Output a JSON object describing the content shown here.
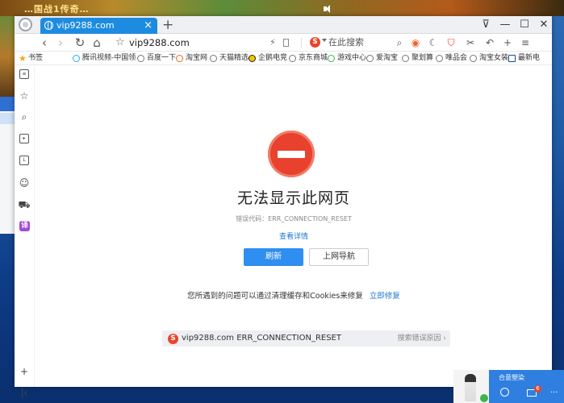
{
  "background": {
    "game_banner_text": "…国战1传奇…"
  },
  "tab": {
    "title": "vip9288.com"
  },
  "toolbar": {
    "url": "vip9288.com",
    "search_placeholder": "在此搜索"
  },
  "bookmarks": [
    {
      "label": "书签",
      "icon": "star-icon"
    },
    {
      "label": "腾讯视频-中国领",
      "icon": "video-icon"
    },
    {
      "label": "百度一下",
      "icon": "globe-icon"
    },
    {
      "label": "淘宝网",
      "icon": "taobao-icon"
    },
    {
      "label": "天猫精选",
      "icon": "globe-icon"
    },
    {
      "label": "企鹅电竞",
      "icon": "penguin-icon"
    },
    {
      "label": "京东商城",
      "icon": "globe-icon"
    },
    {
      "label": "游戏中心",
      "icon": "game-icon"
    },
    {
      "label": "爱淘宝",
      "icon": "globe-icon"
    },
    {
      "label": "聚划算",
      "icon": "globe-icon"
    },
    {
      "label": "唯品会",
      "icon": "globe-icon"
    },
    {
      "label": "淘宝女装",
      "icon": "globe-icon"
    },
    {
      "label": "最新电",
      "icon": "page-icon"
    }
  ],
  "error_page": {
    "title": "无法显示此网页",
    "error_code": "错误代码：ERR_CONNECTION_RESET",
    "detail_link": "查看详情",
    "refresh_button": "刷新",
    "nav_button": "上网导航",
    "hint_text": "您所遇到的问题可以通过清理缓存和Cookies来修复",
    "fix_link": "立即修复",
    "bar_text": "vip9288.com ERR_CONNECTION_RESET",
    "bar_right": "搜索错误原因 ›"
  },
  "notification": {
    "title": "合意塑染",
    "badge_count": "6"
  },
  "colors": {
    "accent": "#2f8ff0",
    "error_red": "#e8412e",
    "tab_blue": "#1d8ce0",
    "link_blue": "#1f78d1"
  }
}
